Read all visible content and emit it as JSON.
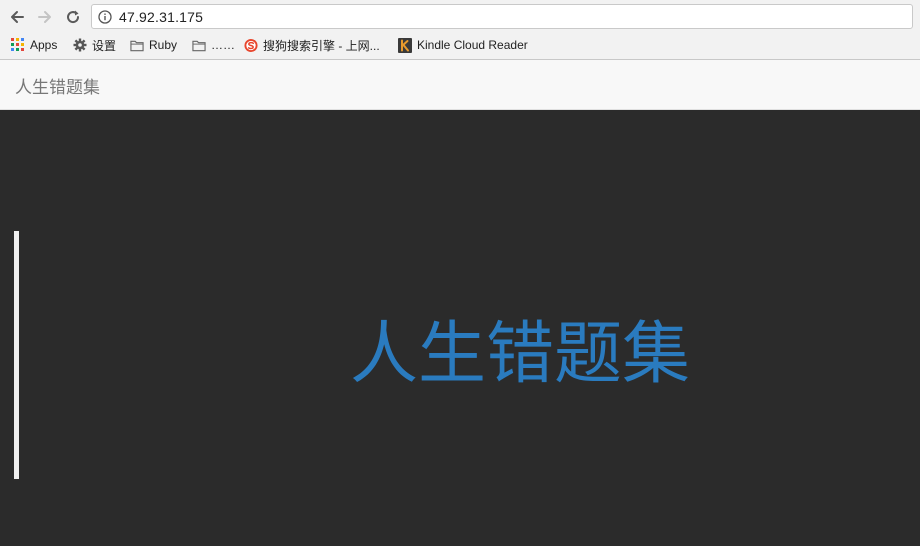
{
  "browser": {
    "url": "47.92.31.175",
    "bookmarks": [
      {
        "label": "Apps",
        "icon": "apps-grid-icon"
      },
      {
        "label": "设置",
        "icon": "gear-icon"
      },
      {
        "label": "Ruby",
        "icon": "folder-icon"
      },
      {
        "label": "……",
        "icon": "folder-icon"
      },
      {
        "label": "搜狗搜索引擎 - 上网...",
        "icon": "sogou-icon"
      },
      {
        "label": "Kindle Cloud Reader",
        "icon": "kindle-icon"
      }
    ]
  },
  "navbar": {
    "brand": "人生错题集"
  },
  "hero": {
    "title": "人生错题集"
  },
  "colors": {
    "hero_background": "#2b2b2b",
    "hero_title": "#2a7bbf",
    "navbar_background": "#f8f8f8",
    "brand_text": "#777777"
  }
}
